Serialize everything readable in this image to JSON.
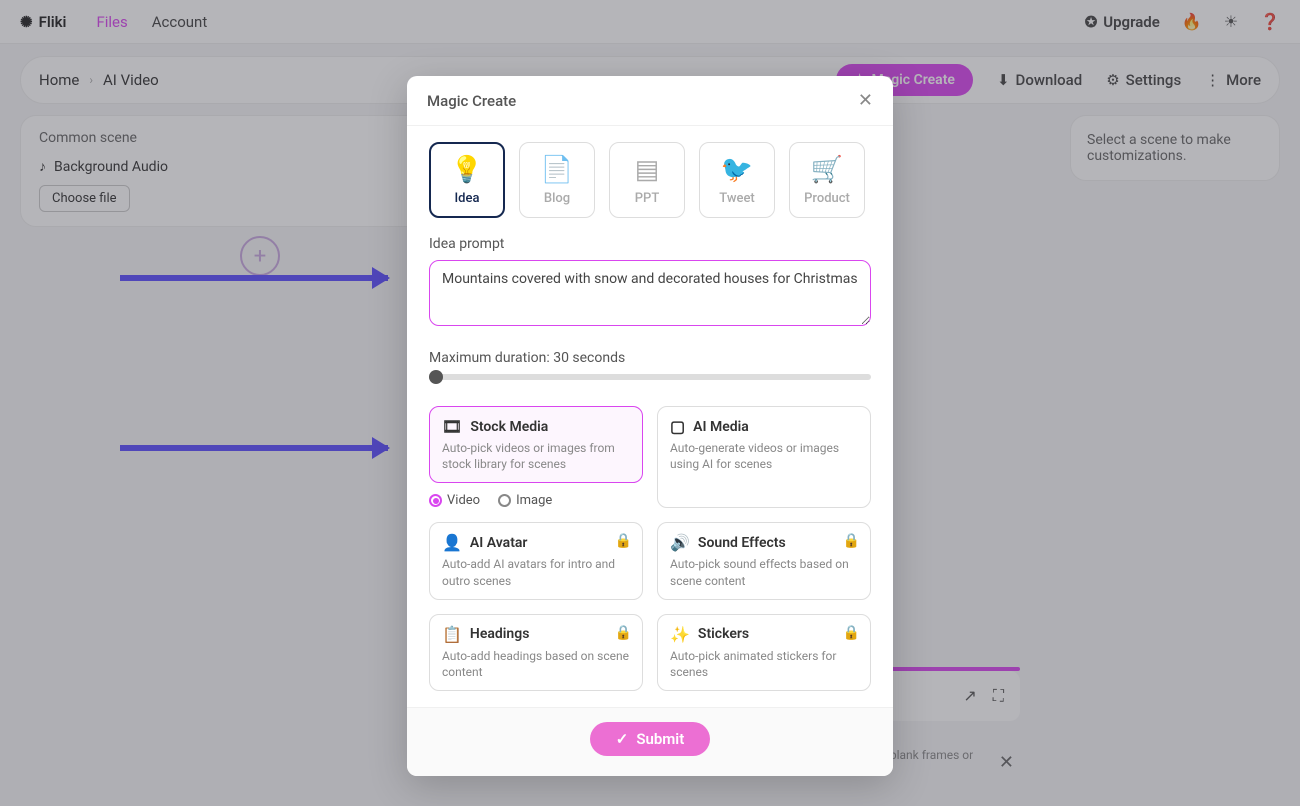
{
  "topbar": {
    "brand": "Fliki",
    "nav": {
      "files": "Files",
      "account": "Account"
    },
    "upgrade": "Upgrade"
  },
  "toolbar": {
    "home": "Home",
    "page": "AI Video",
    "magic": "Magic Create",
    "download": "Download",
    "settings": "Settings",
    "more": "More"
  },
  "left": {
    "common": "Common scene",
    "bgaudio": "Background Audio",
    "choose": "Choose file"
  },
  "right_hint": "Select a scene to make customizations.",
  "toast": "Please note that this is just a quick preview and if you encounter blank frames or silent audio, try playing again.",
  "modal": {
    "title": "Magic Create",
    "tabs": {
      "idea": "Idea",
      "blog": "Blog",
      "ppt": "PPT",
      "tweet": "Tweet",
      "product": "Product"
    },
    "prompt_label": "Idea prompt",
    "prompt_value": "Mountains covered with snow and decorated houses for Christmas",
    "duration_label": "Maximum duration: 30 seconds",
    "opts": {
      "stock": {
        "title": "Stock Media",
        "desc": "Auto-pick videos or images from stock library for scenes"
      },
      "ai_media": {
        "title": "AI Media",
        "desc": "Auto-generate videos or images using AI for scenes"
      },
      "avatar": {
        "title": "AI Avatar",
        "desc": "Auto-add AI avatars for intro and outro scenes"
      },
      "sfx": {
        "title": "Sound Effects",
        "desc": "Auto-pick sound effects based on scene content"
      },
      "headings": {
        "title": "Headings",
        "desc": "Auto-add headings based on scene content"
      },
      "stickers": {
        "title": "Stickers",
        "desc": "Auto-pick animated stickers for scenes"
      }
    },
    "radio": {
      "video": "Video",
      "image": "Image",
      "selected": "video"
    },
    "submit": "Submit"
  }
}
